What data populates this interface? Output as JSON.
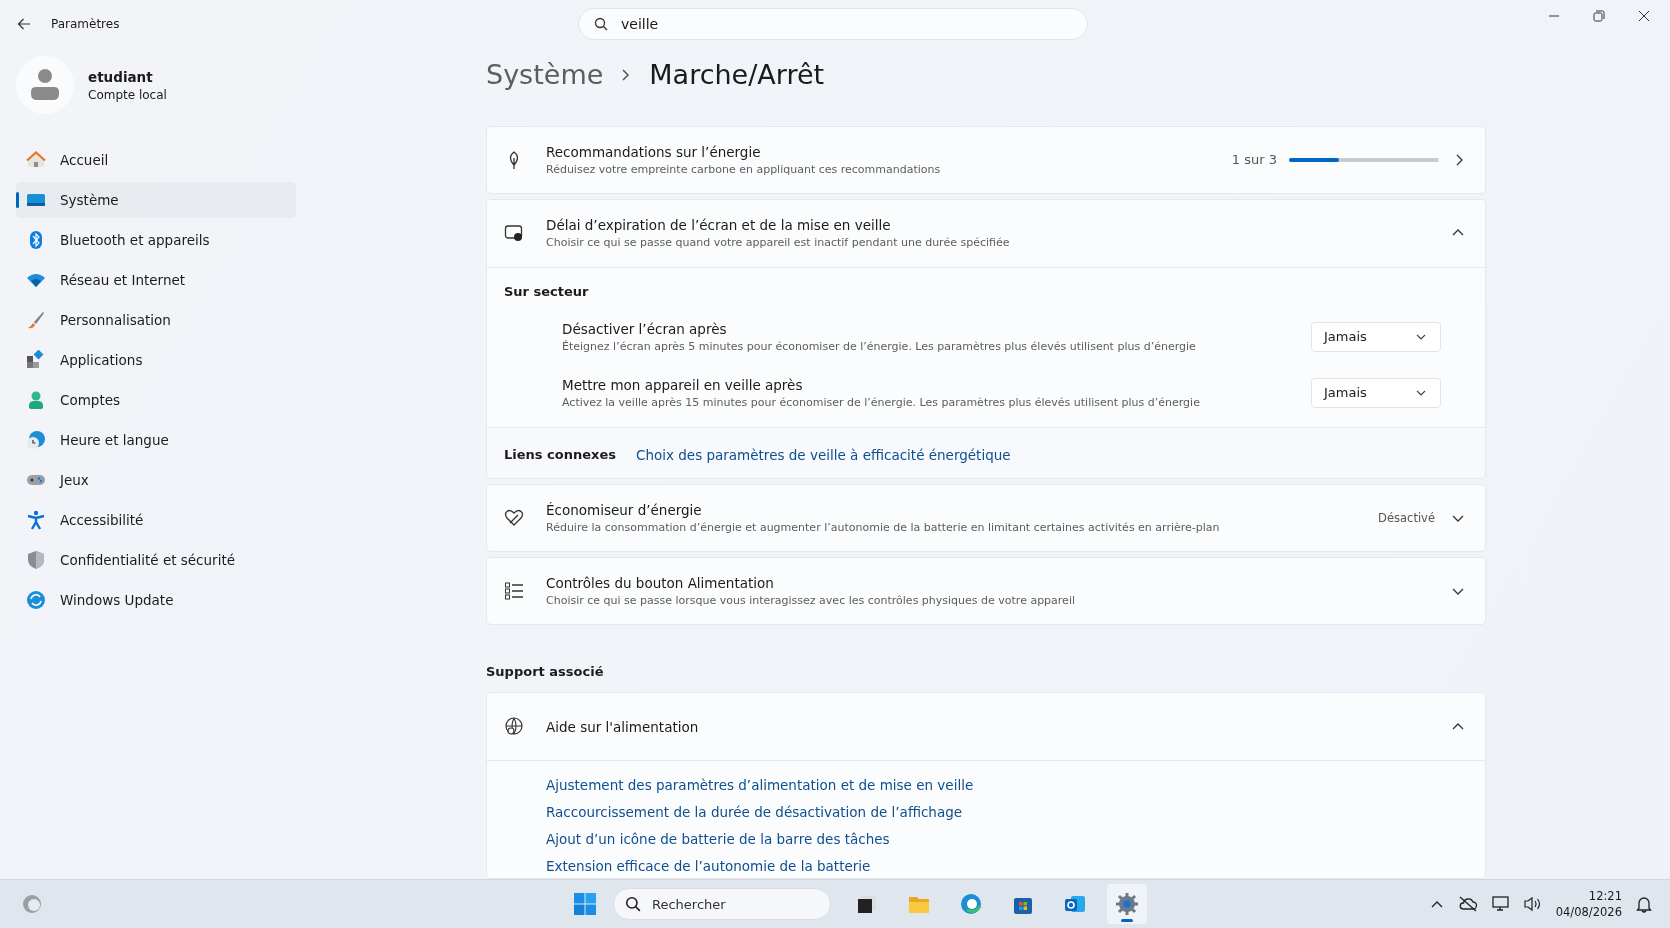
{
  "window": {
    "title": "Paramètres",
    "search": {
      "value": "veille"
    }
  },
  "user": {
    "name": "etudiant",
    "account": "Compte local"
  },
  "sidebar": {
    "items": [
      {
        "label": "Accueil",
        "selected": false
      },
      {
        "label": "Système",
        "selected": true
      },
      {
        "label": "Bluetooth et appareils",
        "selected": false
      },
      {
        "label": "Réseau et Internet",
        "selected": false
      },
      {
        "label": "Personnalisation",
        "selected": false
      },
      {
        "label": "Applications",
        "selected": false
      },
      {
        "label": "Comptes",
        "selected": false
      },
      {
        "label": "Heure et langue",
        "selected": false
      },
      {
        "label": "Jeux",
        "selected": false
      },
      {
        "label": "Accessibilité",
        "selected": false
      },
      {
        "label": "Confidentialité et sécurité",
        "selected": false
      },
      {
        "label": "Windows Update",
        "selected": false
      }
    ]
  },
  "breadcrumb": [
    "Système",
    "Marche/Arrêt"
  ],
  "recommendations": {
    "title": "Recommandations sur l’énergie",
    "subtitle": "Réduisez votre empreinte carbone en appliquant ces recommandations",
    "progress_text": "1 sur 3",
    "level": 0.33
  },
  "timeout": {
    "title": "Délai d’expiration de l’écran et de la mise en veille",
    "subtitle": "Choisir ce qui se passe quand votre appareil est inactif pendant une durée spécifiée",
    "expanded": true,
    "section_title": "Sur secteur",
    "rows": [
      {
        "label": "Désactiver l’écran après",
        "description": "Éteignez l’écran après 5 minutes pour économiser de l’énergie. Les paramètres plus élevés utilisent plus d’énergie",
        "value": "Jamais"
      },
      {
        "label": "Mettre mon appareil en veille après",
        "description": "Activez la veille après 15 minutes pour économiser de l’énergie. Les paramètres plus élevés utilisent plus d’énergie",
        "value": "Jamais"
      }
    ],
    "related_label": "Liens connexes",
    "related_link": "Choix des paramètres de veille à efficacité énergétique"
  },
  "saver": {
    "title": "Économiseur d’énergie",
    "subtitle": "Réduire la consommation d’énergie et augmenter l’autonomie de la batterie en limitant certaines activités en arrière-plan",
    "status": "Désactivé",
    "expanded": false
  },
  "power_buttons": {
    "title": "Contrôles du bouton Alimentation",
    "subtitle": "Choisir ce qui se passe lorsque vous interagissez avec les contrôles physiques de votre appareil",
    "expanded": false
  },
  "support": {
    "heading": "Support associé",
    "title": "Aide sur l'alimentation",
    "expanded": true,
    "links": [
      "Ajustement des paramètres d’alimentation et de mise en veille",
      "Raccourcissement de la durée de désactivation de l’affichage",
      "Ajout d’un icône de batterie de la barre des tâches",
      "Extension efficace de l’autonomie de la batterie"
    ]
  },
  "taskbar": {
    "search_placeholder": "Rechercher",
    "time": "12:21",
    "date": "04/08/2026",
    "apps": [
      {
        "selected": false
      },
      {
        "selected": false
      },
      {
        "selected": false
      },
      {
        "selected": false
      },
      {
        "selected": false
      },
      {
        "selected": true
      }
    ]
  }
}
